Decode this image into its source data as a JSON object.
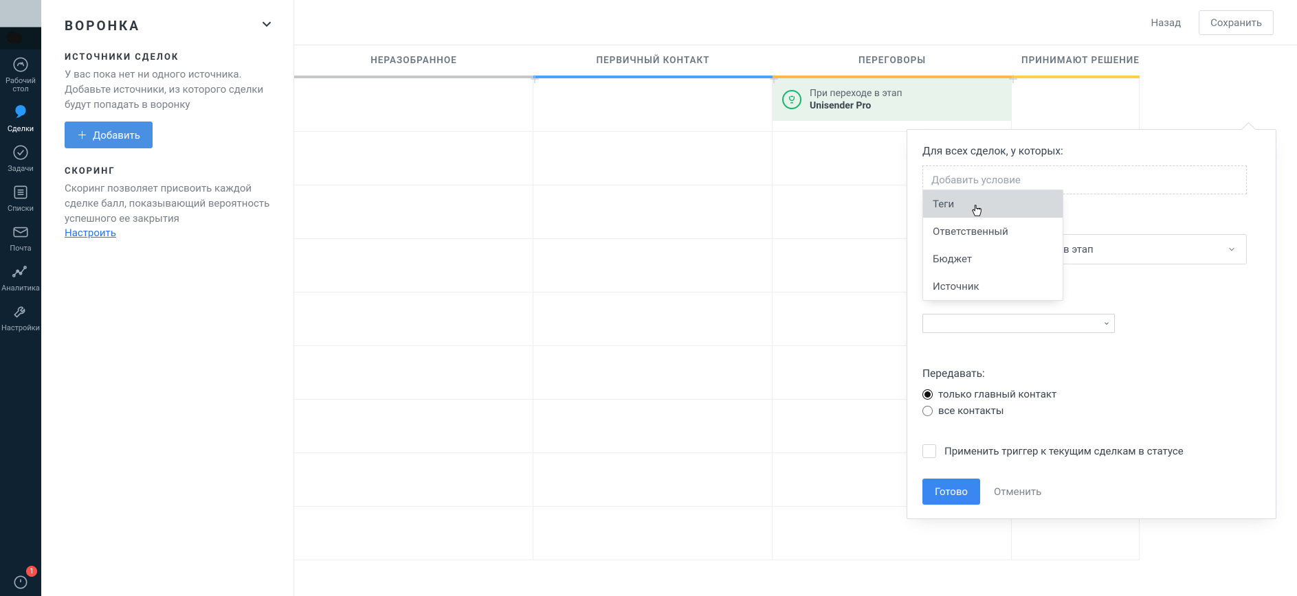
{
  "nav": {
    "items": [
      {
        "label": "Рабочий\nстол"
      },
      {
        "label": "Сделки"
      },
      {
        "label": "Задачи"
      },
      {
        "label": "Списки"
      },
      {
        "label": "Почта"
      },
      {
        "label": "Аналитика"
      },
      {
        "label": "Настройки"
      }
    ],
    "badge": "1"
  },
  "side": {
    "title": "ВОРОНКА",
    "sources": {
      "heading": "ИСТОЧНИКИ СДЕЛОК",
      "text": "У вас пока нет ни одного источника. Добавьте источники, из которого сделки будут попадать в воронку",
      "button": "Добавить"
    },
    "scoring": {
      "heading": "СКОРИНГ",
      "text": "Скоринг позволяет присвоить каждой сделке балл, показывающий вероятность успешного ее закрытия",
      "link": "Настроить"
    }
  },
  "topbar": {
    "back": "Назад",
    "save": "Сохранить"
  },
  "pipeline": {
    "cols": [
      {
        "label": "НЕРАЗОБРАННОЕ"
      },
      {
        "label": "ПЕРВИЧНЫЙ КОНТАКТ"
      },
      {
        "label": "ПЕРЕГОВОРЫ"
      },
      {
        "label": "ПРИНИМАЮТ РЕШЕНИЕ"
      }
    ]
  },
  "trigger": {
    "title": "При переходе в этап",
    "name": "Unisender Pro"
  },
  "popover": {
    "cond_label": "Для всех сделок, у которых:",
    "cond_placeholder": "Добавить условие",
    "options": [
      "Теги",
      "Ответственный",
      "Бюджет",
      "Источник"
    ],
    "stage_select": "в этап",
    "pass_label": "Передавать:",
    "radio1": "только главный контакт",
    "radio2": "все контакты",
    "apply_current": "Применить триггер к текущим сделкам в статусе",
    "done": "Готово",
    "cancel": "Отменить"
  }
}
